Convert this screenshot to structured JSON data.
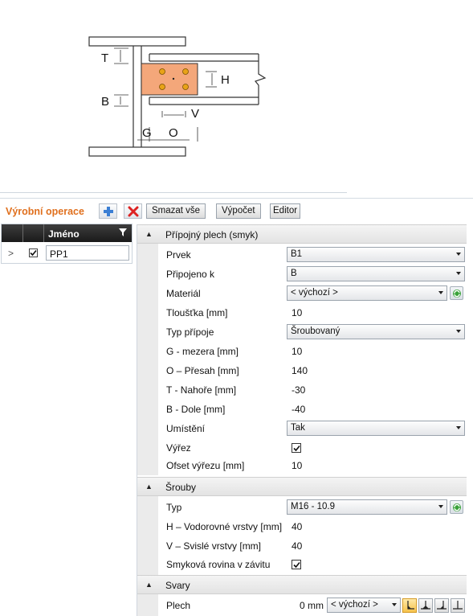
{
  "drawing": {
    "label_T": "T",
    "label_B": "B",
    "label_H": "H",
    "label_V": "V",
    "label_G": "G",
    "label_O": "O"
  },
  "toolbar": {
    "title": "Výrobní operace",
    "add_icon": "plus-icon",
    "delete_icon": "red-x-icon",
    "delete_all_label": "Smazat vše",
    "calculate_label": "Výpočet",
    "editor_label": "Editor"
  },
  "grid": {
    "column_name": "Jméno",
    "rows": [
      {
        "checked": true,
        "name": "PP1"
      }
    ]
  },
  "properties": {
    "sections": [
      {
        "title": "Přípojný plech (smyk)",
        "rows": [
          {
            "label": "Prvek",
            "type": "combo",
            "value": "B1"
          },
          {
            "label": "Připojeno k",
            "type": "combo",
            "value": "B"
          },
          {
            "label": "Materiál",
            "type": "combo-refresh",
            "value": "< výchozí >"
          },
          {
            "label": "Tloušťka [mm]",
            "type": "text",
            "value": "10"
          },
          {
            "label": "Typ přípoje",
            "type": "combo",
            "value": "Šroubovaný"
          },
          {
            "label": "G - mezera [mm]",
            "type": "text",
            "value": "10"
          },
          {
            "label": "O – Přesah [mm]",
            "type": "text",
            "value": "140"
          },
          {
            "label": "T - Nahoře [mm]",
            "type": "text",
            "value": "-30"
          },
          {
            "label": "B - Dole [mm]",
            "type": "text",
            "value": "-40"
          },
          {
            "label": "Umístění",
            "type": "combo",
            "value": "Tak"
          },
          {
            "label": "Výřez",
            "type": "check",
            "value": true
          },
          {
            "label": "Ofset výřezu [mm]",
            "type": "text",
            "value": "10"
          }
        ]
      },
      {
        "title": "Šrouby",
        "rows": [
          {
            "label": "Typ",
            "type": "combo-refresh",
            "value": "M16 - 10.9"
          },
          {
            "label": "H – Vodorovné vrstvy [mm]",
            "type": "text",
            "value": "40"
          },
          {
            "label": "V – Svislé vrstvy [mm]",
            "type": "text",
            "value": "40"
          },
          {
            "label": "Smyková rovina v závitu",
            "type": "check",
            "value": true
          }
        ]
      },
      {
        "title": "Svary",
        "rows": [
          {
            "label": "Plech",
            "type": "weld",
            "value": "0 mm",
            "combo": "< výchozí >"
          }
        ]
      }
    ]
  },
  "colors": {
    "accent": "#e0701e",
    "plate": "#f4a77a",
    "bolt": "#e8a317"
  }
}
